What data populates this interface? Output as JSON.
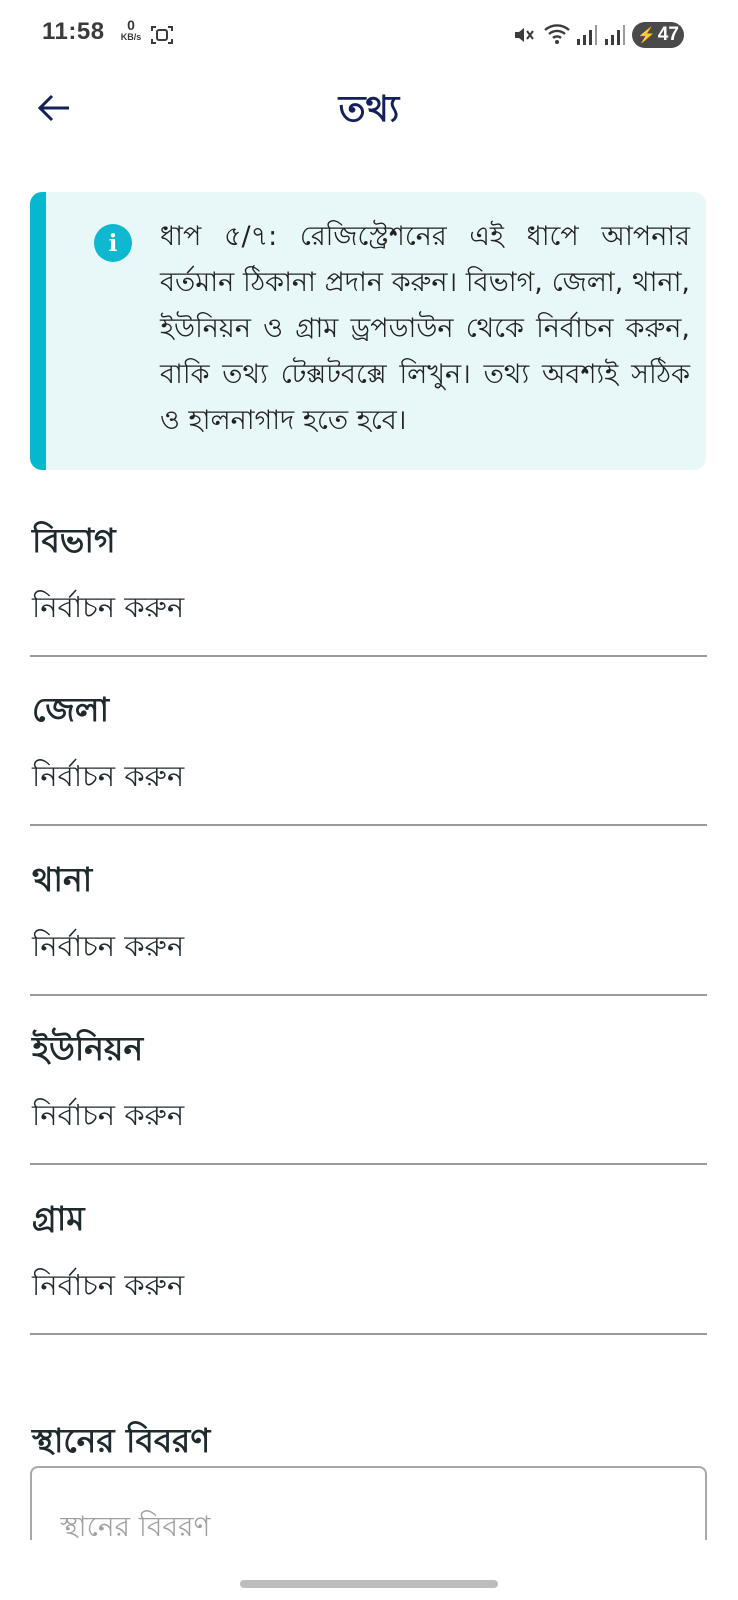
{
  "status_bar": {
    "time": "11:58",
    "net_speed_value": "0",
    "net_speed_unit": "KB/s",
    "battery_level": "47",
    "icons": [
      "screenshot-icon",
      "mute-icon",
      "wifi-icon",
      "signal-icon",
      "signal-icon",
      "battery-charging-icon"
    ]
  },
  "app_bar": {
    "title": "তথ্য",
    "back_icon": "arrow-left-icon"
  },
  "info_card": {
    "icon": "info-icon",
    "text": "ধাপ ৫/৭: রেজিস্ট্রেশনের এই ধাপে আপনার বর্তমান ঠিকানা প্রদান করুন। বিভাগ, জেলা, থানা, ইউনিয়ন ও গ্রাম ড্রপডাউন থেকে নির্বাচন করুন, বাকি তথ্য টেক্সটবক্সে লিখুন। তথ্য অবশ্যই সঠিক ও হালনাগাদ হতে হবে।",
    "accent_color": "#06b8cf",
    "background_color": "#e8f8f9"
  },
  "fields": [
    {
      "label": "বিভাগ",
      "value": "নির্বাচন করুন"
    },
    {
      "label": "জেলা",
      "value": "নির্বাচন করুন"
    },
    {
      "label": "থানা",
      "value": "নির্বাচন করুন"
    },
    {
      "label": "ইউনিয়ন",
      "value": "নির্বাচন করুন"
    },
    {
      "label": "গ্রাম",
      "value": "নির্বাচন করুন"
    }
  ],
  "place_description": {
    "label": "স্থানের বিবরণ",
    "placeholder": "স্থানের বিবরণ",
    "value": ""
  },
  "colors": {
    "title": "#13205a",
    "text": "#1f2a2e"
  }
}
